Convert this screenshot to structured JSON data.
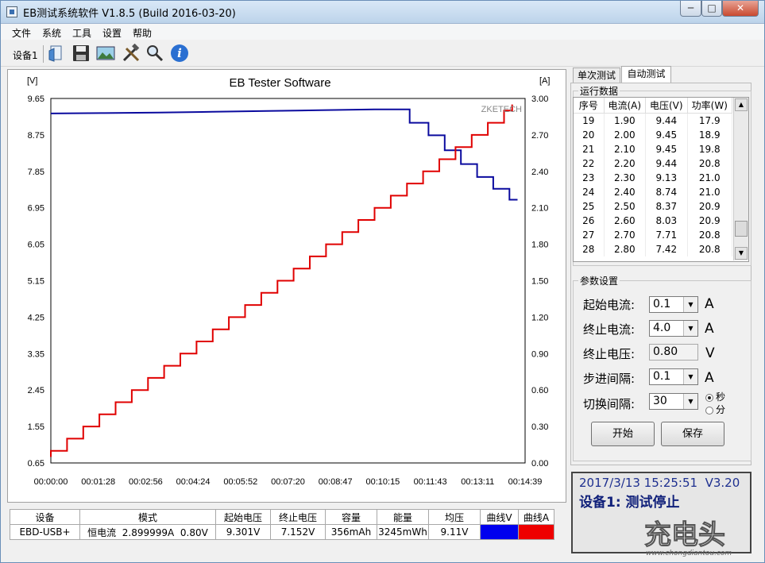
{
  "window": {
    "title": "EB测试系统软件 V1.8.5 (Build 2016-03-20)",
    "min": "─",
    "max": "□",
    "close": "✕"
  },
  "menu": [
    "文件",
    "系统",
    "工具",
    "设置",
    "帮助"
  ],
  "toolbar": {
    "device_label": "设备1",
    "icons": [
      "open-folder-icon",
      "save-icon",
      "image-icon",
      "tools-icon",
      "search-icon",
      "info-icon"
    ]
  },
  "chart_data": {
    "type": "line",
    "title": "EB Tester Software",
    "brand": "ZKETECH",
    "left_unit": "[V]",
    "right_unit": "[A]",
    "x_ticks": [
      "00:00:00",
      "00:01:28",
      "00:02:56",
      "00:04:24",
      "00:05:52",
      "00:07:20",
      "00:08:47",
      "00:10:15",
      "00:11:43",
      "00:13:11",
      "00:14:39"
    ],
    "x_range_seconds": [
      0,
      879
    ],
    "left_ticks": [
      "9.65",
      "8.75",
      "7.85",
      "6.95",
      "6.05",
      "5.15",
      "4.25",
      "3.35",
      "2.45",
      "1.55",
      "0.65"
    ],
    "left_range": [
      0.65,
      9.65
    ],
    "right_ticks": [
      "3.00",
      "2.70",
      "2.40",
      "2.10",
      "1.80",
      "1.50",
      "1.20",
      "0.90",
      "0.60",
      "0.30",
      "0.00"
    ],
    "right_range": [
      0.0,
      3.0
    ],
    "grid": true,
    "series": [
      {
        "name": "曲线V",
        "axis": "left",
        "color": "#0a0a9e",
        "points": [
          [
            0,
            9.28
          ],
          [
            100,
            9.29
          ],
          [
            200,
            9.3
          ],
          [
            300,
            9.32
          ],
          [
            400,
            9.34
          ],
          [
            500,
            9.36
          ],
          [
            600,
            9.38
          ],
          [
            665,
            9.38
          ],
          [
            665,
            9.05
          ],
          [
            700,
            9.05
          ],
          [
            700,
            8.74
          ],
          [
            730,
            8.74
          ],
          [
            730,
            8.37
          ],
          [
            760,
            8.37
          ],
          [
            760,
            8.03
          ],
          [
            790,
            8.03
          ],
          [
            790,
            7.71
          ],
          [
            820,
            7.71
          ],
          [
            820,
            7.42
          ],
          [
            850,
            7.42
          ],
          [
            850,
            7.15
          ],
          [
            865,
            7.15
          ]
        ]
      },
      {
        "name": "曲线A",
        "axis": "right",
        "color": "#e00000",
        "points": [
          [
            0,
            0.05
          ],
          [
            0,
            0.1
          ],
          [
            30,
            0.1
          ],
          [
            30,
            0.2
          ],
          [
            60,
            0.2
          ],
          [
            60,
            0.3
          ],
          [
            90,
            0.3
          ],
          [
            90,
            0.4
          ],
          [
            120,
            0.4
          ],
          [
            120,
            0.5
          ],
          [
            150,
            0.5
          ],
          [
            150,
            0.6
          ],
          [
            180,
            0.6
          ],
          [
            180,
            0.7
          ],
          [
            210,
            0.7
          ],
          [
            210,
            0.8
          ],
          [
            240,
            0.8
          ],
          [
            240,
            0.9
          ],
          [
            270,
            0.9
          ],
          [
            270,
            1.0
          ],
          [
            300,
            1.0
          ],
          [
            300,
            1.1
          ],
          [
            330,
            1.1
          ],
          [
            330,
            1.2
          ],
          [
            360,
            1.2
          ],
          [
            360,
            1.3
          ],
          [
            390,
            1.3
          ],
          [
            390,
            1.4
          ],
          [
            420,
            1.4
          ],
          [
            420,
            1.5
          ],
          [
            450,
            1.5
          ],
          [
            450,
            1.6
          ],
          [
            480,
            1.6
          ],
          [
            480,
            1.7
          ],
          [
            510,
            1.7
          ],
          [
            510,
            1.8
          ],
          [
            540,
            1.8
          ],
          [
            540,
            1.9
          ],
          [
            570,
            1.9
          ],
          [
            570,
            2.0
          ],
          [
            600,
            2.0
          ],
          [
            600,
            2.1
          ],
          [
            630,
            2.1
          ],
          [
            630,
            2.2
          ],
          [
            660,
            2.2
          ],
          [
            660,
            2.3
          ],
          [
            690,
            2.3
          ],
          [
            690,
            2.4
          ],
          [
            720,
            2.4
          ],
          [
            720,
            2.5
          ],
          [
            750,
            2.5
          ],
          [
            750,
            2.6
          ],
          [
            780,
            2.6
          ],
          [
            780,
            2.7
          ],
          [
            810,
            2.7
          ],
          [
            810,
            2.8
          ],
          [
            840,
            2.8
          ],
          [
            840,
            2.9
          ],
          [
            855,
            2.9
          ],
          [
            855,
            2.95
          ]
        ]
      }
    ]
  },
  "tabs": [
    "单次测试",
    "自动测试"
  ],
  "run_data": {
    "title": "运行数据",
    "headers": [
      "序号",
      "电流(A)",
      "电压(V)",
      "功率(W)"
    ],
    "rows": [
      [
        "19",
        "1.90",
        "9.44",
        "17.9"
      ],
      [
        "20",
        "2.00",
        "9.45",
        "18.9"
      ],
      [
        "21",
        "2.10",
        "9.45",
        "19.8"
      ],
      [
        "22",
        "2.20",
        "9.44",
        "20.8"
      ],
      [
        "23",
        "2.30",
        "9.13",
        "21.0"
      ],
      [
        "24",
        "2.40",
        "8.74",
        "21.0"
      ],
      [
        "25",
        "2.50",
        "8.37",
        "20.9"
      ],
      [
        "26",
        "2.60",
        "8.03",
        "20.9"
      ],
      [
        "27",
        "2.70",
        "7.71",
        "20.8"
      ],
      [
        "28",
        "2.80",
        "7.42",
        "20.8"
      ]
    ]
  },
  "params": {
    "title": "参数设置",
    "start_current": {
      "label": "起始电流:",
      "value": "0.1",
      "unit": "A"
    },
    "end_current": {
      "label": "终止电流:",
      "value": "4.0",
      "unit": "A"
    },
    "end_voltage": {
      "label": "终止电压:",
      "value": "0.80",
      "unit": "V"
    },
    "step": {
      "label": "步进间隔:",
      "value": "0.1",
      "unit": "A"
    },
    "interval": {
      "label": "切换间隔:",
      "value": "30",
      "opt_sec": "秒",
      "opt_min": "分"
    },
    "start_button": "开始",
    "save_button": "保存"
  },
  "status": {
    "datetime": "2017/3/13 15:25:51",
    "version": "V3.20",
    "message": "设备1: 测试停止"
  },
  "summary": {
    "headers": [
      "设备",
      "模式",
      "起始电压",
      "终止电压",
      "容量",
      "能量",
      "均压",
      "曲线V",
      "曲线A"
    ],
    "row": [
      "EBD-USB+",
      "恒电流  2.899999A  0.80V",
      "9.301V",
      "7.152V",
      "356mAh",
      "3245mWh",
      "9.11V"
    ],
    "color_v": "#0000ee",
    "color_a": "#ee0000"
  },
  "watermark": {
    "text": "充电头",
    "url": "www.chongdiantou.com"
  }
}
